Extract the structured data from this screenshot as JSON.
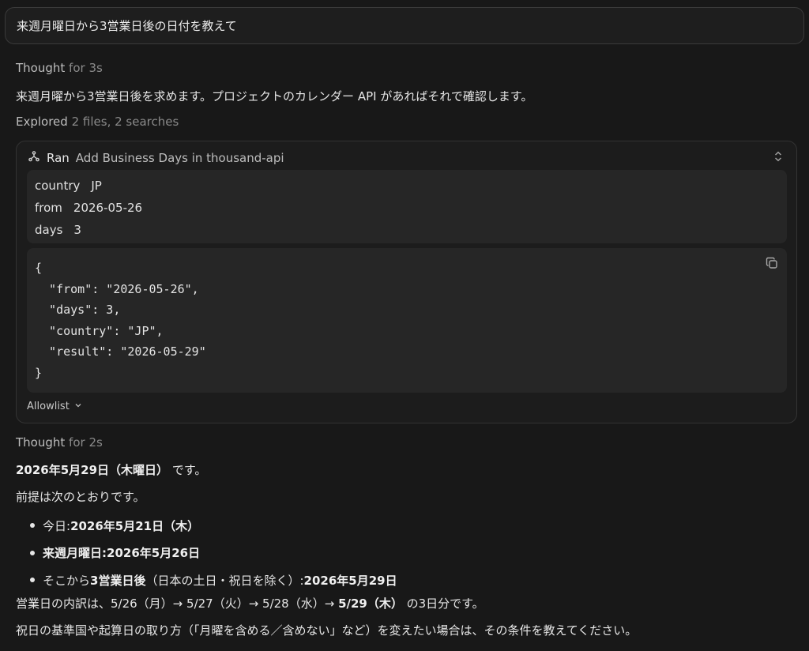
{
  "prompt": {
    "text": "来週月曜日から3営業日後の日付を教えて"
  },
  "thought1": {
    "label": "Thought",
    "duration": "for 3s"
  },
  "intro_text": "来週月曜から3営業日後を求めます。プロジェクトのカレンダー API があればそれで確認します。",
  "explored": {
    "label": "Explored",
    "detail": "2 files, 2 searches"
  },
  "tool_call": {
    "icon": "tool-fork-icon",
    "ran_label": "Ran",
    "name": "Add Business Days in thousand-api",
    "params": [
      {
        "key": "country",
        "value": "JP"
      },
      {
        "key": "from",
        "value": "2026-05-26"
      },
      {
        "key": "days",
        "value": "3"
      }
    ],
    "output_lines": [
      "{",
      "  \"from\": \"2026-05-26\",",
      "  \"days\": 3,",
      "  \"country\": \"JP\",",
      "  \"result\": \"2026-05-29\"",
      "}"
    ],
    "allowlist_label": "Allowlist"
  },
  "thought2": {
    "label": "Thought",
    "duration": "for 2s"
  },
  "answer": {
    "headline_bold": "2026年5月29日（木曜日）",
    "headline_rest": " です。",
    "premise": "前提は次のとおりです。",
    "bullets": [
      {
        "pre": "今日: ",
        "bold": "2026年5月21日（木）",
        "mid": "",
        "bold2": "",
        "post": ""
      },
      {
        "pre": "",
        "bold": "来週月曜日",
        "mid": ": ",
        "bold2": "2026年5月26日",
        "post": ""
      },
      {
        "pre": "そこから ",
        "bold": "3営業日後",
        "mid": "（日本の土日・祝日を除く）: ",
        "bold2": "2026年5月29日",
        "post": ""
      }
    ],
    "breakdown_pre": "営業日の内訳は、5/26（月）→ 5/27（火）→ 5/28（水）→ ",
    "breakdown_bold": "5/29（木）",
    "breakdown_post": " の3日分です。",
    "closing": "祝日の基準国や起算日の取り方（「月曜を含める／含めない」など）を変えたい場合は、その条件を教えてください。"
  }
}
